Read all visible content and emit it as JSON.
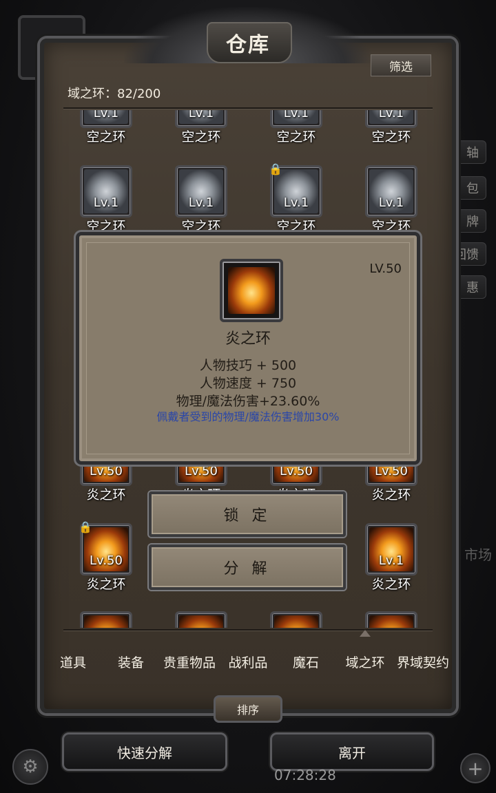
{
  "window": {
    "title": "仓库",
    "filter_label": "筛选"
  },
  "inventory": {
    "category": "域之环",
    "count_label": "域之环：82/200"
  },
  "grid": {
    "slots": [
      {
        "lv": "Lv.1",
        "name": "空之环",
        "icon": "cloud-ring-icon",
        "locked": false
      },
      {
        "lv": "Lv.1",
        "name": "空之环",
        "icon": "cloud-ring-icon",
        "locked": false
      },
      {
        "lv": "Lv.1",
        "name": "空之环",
        "icon": "cloud-ring-icon",
        "locked": false
      },
      {
        "lv": "Lv.1",
        "name": "空之环",
        "icon": "cloud-ring-icon",
        "locked": false
      },
      {
        "lv": "Lv.1",
        "name": "空之环",
        "icon": "cloud-ring-icon",
        "locked": false
      },
      {
        "lv": "Lv.1",
        "name": "空之环",
        "icon": "cloud-ring-icon",
        "locked": false
      },
      {
        "lv": "Lv.1",
        "name": "空之环",
        "icon": "cloud-ring-icon",
        "locked": true
      },
      {
        "lv": "Lv.1",
        "name": "空之环",
        "icon": "cloud-ring-icon",
        "locked": false
      },
      {
        "lv": "Lv.50",
        "name": "炎之环",
        "icon": "fire-ring-icon",
        "locked": false
      },
      {
        "lv": "Lv.50",
        "name": "炎之环",
        "icon": "fire-ring-icon",
        "locked": false
      },
      {
        "lv": "Lv.50",
        "name": "炎之环",
        "icon": "fire-ring-icon",
        "locked": false
      },
      {
        "lv": "Lv.50",
        "name": "炎之环",
        "icon": "fire-ring-icon",
        "locked": false
      },
      {
        "lv": "Lv.50",
        "name": "炎之环",
        "icon": "fire-ring-icon",
        "locked": true
      },
      {
        "lv": "Lv.1",
        "name": "炎之环",
        "icon": "fire-ring-icon",
        "locked": false
      }
    ]
  },
  "tooltip": {
    "level": "LV.50",
    "name": "炎之环",
    "icon": "fire-ring-icon",
    "stats": [
      "人物技巧 + 500",
      "人物速度 + 750",
      "物理/魔法伤害+23.60%"
    ],
    "effect": "佩戴者受到的物理/魔法伤害增加30%",
    "effect_color": "#2a46a8"
  },
  "actions": {
    "lock": "锁 定",
    "disassemble": "分 解"
  },
  "tabs": [
    "道具",
    "装备",
    "贵重物品",
    "战利品",
    "魔石",
    "域之环",
    "界域契约"
  ],
  "active_tab": "域之环",
  "sort_label": "排序",
  "bottom": {
    "quick_disassemble": "快速分解",
    "leave": "离开"
  },
  "background": {
    "side_labels": [
      "轴",
      "包",
      "牌",
      "回馈",
      "惠"
    ],
    "market": "市场",
    "clock": "07:28:28"
  }
}
